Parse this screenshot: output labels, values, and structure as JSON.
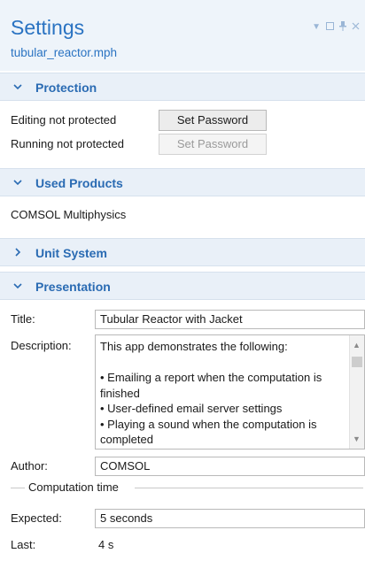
{
  "panel": {
    "title": "Settings",
    "filename": "tubular_reactor.mph",
    "window_controls": [
      "dropdown-icon",
      "maximize-icon",
      "pin-icon",
      "close-icon"
    ]
  },
  "protection": {
    "header": "Protection",
    "editing_label": "Editing not protected",
    "running_label": "Running not protected",
    "set_password_label": "Set Password",
    "set_password_disabled_label": "Set Password"
  },
  "used_products": {
    "header": "Used Products",
    "product": "COMSOL Multiphysics"
  },
  "unit_system": {
    "header": "Unit System"
  },
  "presentation": {
    "header": "Presentation",
    "title_label": "Title:",
    "title_value": "Tubular Reactor with Jacket",
    "description_label": "Description:",
    "description_value": "This app demonstrates the following:\n\n• Emailing a report when the computation is finished\n• User-defined email server settings\n• Playing a sound when the computation is completed",
    "author_label": "Author:",
    "author_value": "COMSOL",
    "computation_time_label": "Computation time",
    "expected_label": "Expected:",
    "expected_value": "5 seconds",
    "last_label": "Last:",
    "last_value": "4 s"
  },
  "colors": {
    "accent": "#2a73c2",
    "section_bg": "#e9f0f8",
    "header_bg": "#eef4fa"
  }
}
